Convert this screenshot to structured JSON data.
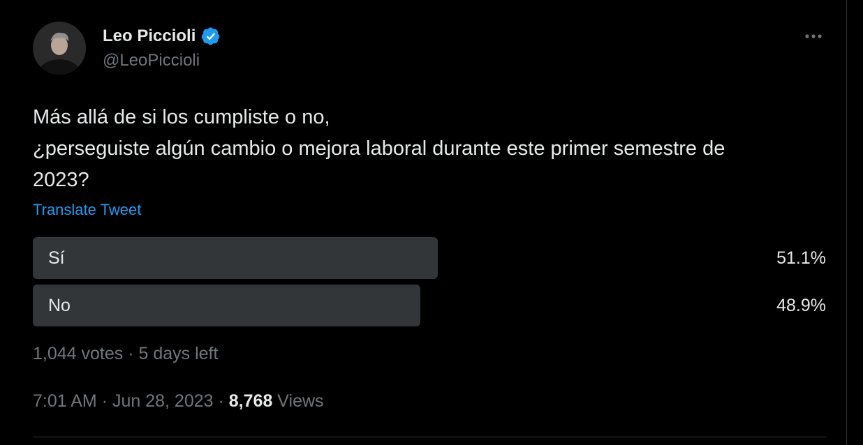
{
  "author": {
    "display_name": "Leo Piccioli",
    "handle": "@LeoPiccioli",
    "verified": true
  },
  "tweet": {
    "text_line1": "Más allá de si los cumpliste o no,",
    "text_line2": "¿perseguiste algún cambio o mejora laboral durante este primer semestre de",
    "text_line3": "2023?",
    "translate_label": "Translate Tweet"
  },
  "poll": {
    "options": [
      {
        "label": "Sí",
        "percent_label": "51.1%",
        "percent": 51.1
      },
      {
        "label": "No",
        "percent_label": "48.9%",
        "percent": 48.9
      }
    ],
    "votes_label": "1,044 votes",
    "separator": "·",
    "time_left_label": "5 days left"
  },
  "meta": {
    "time": "7:01 AM",
    "date": "Jun 28, 2023",
    "separator": "·",
    "views_count": "8,768",
    "views_label": "Views"
  },
  "colors": {
    "background": "#000000",
    "text": "#e7e9ea",
    "secondary_text": "#71767b",
    "link": "#1d9bf0",
    "verified_badge": "#1d9bf0",
    "poll_bar": "#333639"
  },
  "icons": {
    "verified": "verified-badge-icon",
    "more": "more-horizontal-icon"
  }
}
